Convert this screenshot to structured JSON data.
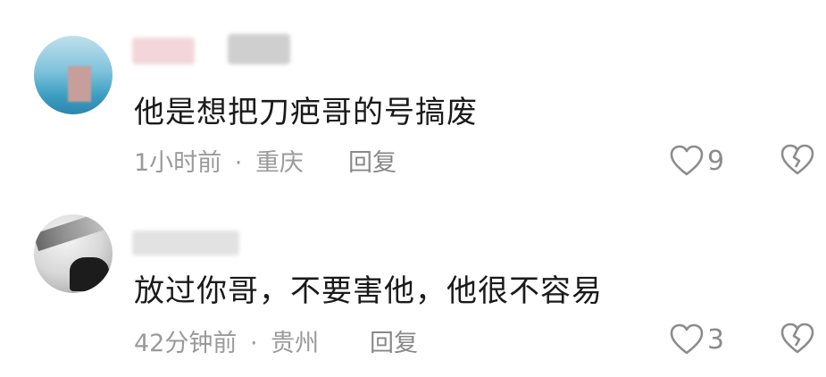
{
  "comments": [
    {
      "text": "他是想把刀疤哥的号搞废",
      "time": "1小时前",
      "separator": "·",
      "location": "重庆",
      "reply_label": "回复",
      "like_count": "9",
      "like_icon": "heart-outline-icon",
      "dislike_icon": "broken-heart-icon"
    },
    {
      "text": "放过你哥，不要害他，他很不容易",
      "time": "42分钟前",
      "separator": "·",
      "location": "贵州",
      "reply_label": "回复",
      "like_count": "3",
      "like_icon": "heart-outline-icon",
      "dislike_icon": "broken-heart-icon"
    }
  ],
  "colors": {
    "text": "#1a1a1a",
    "meta": "#9a9a9a",
    "icon": "#8c8c8c"
  }
}
